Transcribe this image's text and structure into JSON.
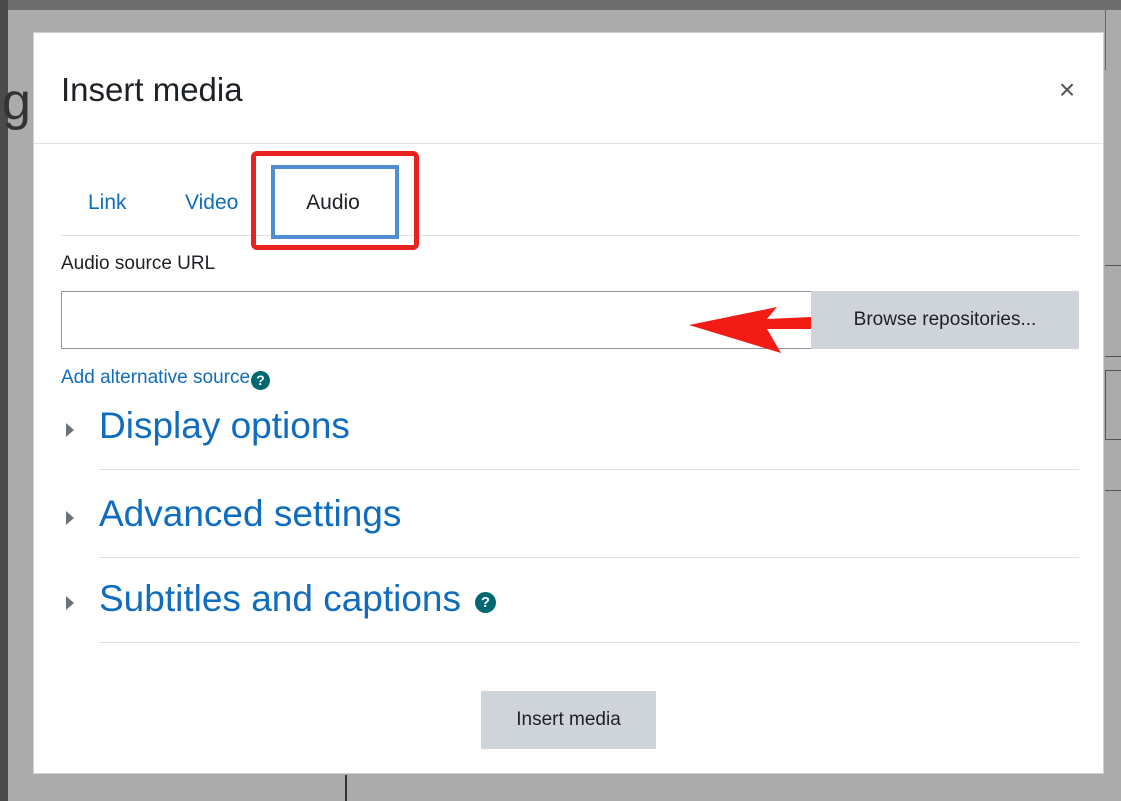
{
  "background": {
    "partial_letter": "g"
  },
  "modal": {
    "title": "Insert media",
    "close_symbol": "×",
    "tabs": [
      {
        "label": "Link",
        "active": false
      },
      {
        "label": "Video",
        "active": false
      },
      {
        "label": "Audio",
        "active": true
      }
    ],
    "audio_source": {
      "label": "Audio source URL",
      "value": "",
      "browse_label": "Browse repositories..."
    },
    "add_alt_source_label": "Add alternative source",
    "sections": [
      {
        "title": "Display options",
        "expanded": false
      },
      {
        "title": "Advanced settings",
        "expanded": false
      },
      {
        "title": "Subtitles and captions",
        "expanded": false
      }
    ],
    "insert_button_label": "Insert media"
  },
  "annotations": {
    "highlight_color": "#e8231f",
    "tab_focus_color": "#4f8fd1",
    "arrow_color": "#f21c14"
  },
  "colors": {
    "link": "#0f6cbf",
    "help_icon": "#006870",
    "button_bg": "#ced4da"
  },
  "icons": {
    "help": "question-circle",
    "close": "times",
    "section_toggle": "caret-right"
  }
}
